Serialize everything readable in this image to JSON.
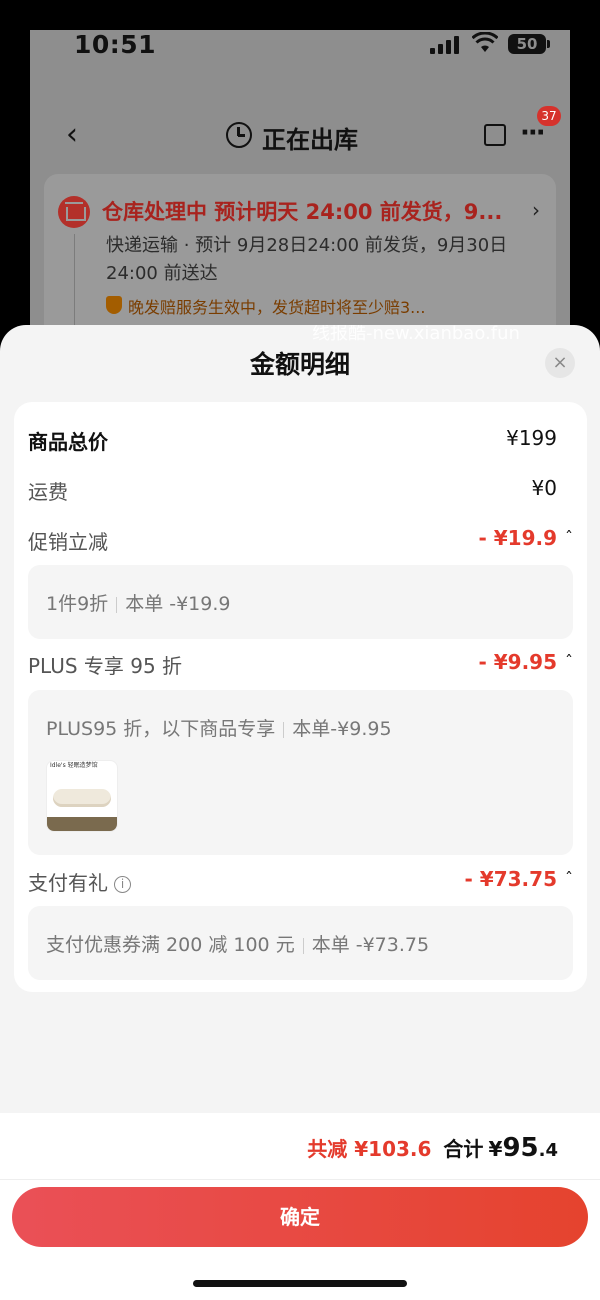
{
  "status_bar": {
    "time": "10:51",
    "battery": "50"
  },
  "nav": {
    "title": "正在出库",
    "badge": "37"
  },
  "status_card": {
    "headline": "仓库处理中  预计明天 24:00 前发货，9...",
    "detail": "快递运输 · 预计 9月28日24:00 前发货，9月30日24:00 前送达",
    "guarantee_tag": "晚发赔",
    "guarantee_text": "晚发赔服务生效中，发货超时将至少赔3..."
  },
  "watermark": "线报酷-new.xianbao.fun",
  "sheet": {
    "title": "金额明细",
    "close_icon": "×",
    "rows": {
      "goods_total": {
        "label": "商品总价",
        "value": "¥199"
      },
      "shipping": {
        "label": "运费",
        "value": "¥0"
      },
      "promo": {
        "label": "促销立减",
        "value": "- ¥19.9",
        "detail_a": "1件9折",
        "detail_b": "本单 -¥19.9"
      },
      "plus": {
        "label": "PLUS 专享 95 折",
        "value": "- ¥9.95",
        "detail_a": "PLUS95 折，以下商品专享",
        "detail_b": "本单-¥9.95",
        "thumb_brand": "Idle's 轻眠造梦馆"
      },
      "payment": {
        "label": "支付有礼",
        "value": "- ¥73.75",
        "detail_a": "支付优惠券满 200 减 100 元",
        "detail_b": "本单 -¥73.75"
      }
    }
  },
  "footer": {
    "saved": "共减 ¥103.6",
    "total_label": "合计",
    "total_symbol": "¥",
    "total_int": "95",
    "total_dec": ".4",
    "confirm": "确定"
  },
  "colors": {
    "discount": "#e43a2c",
    "button": "#e5432e",
    "backdrop": "#8e8e8e"
  }
}
